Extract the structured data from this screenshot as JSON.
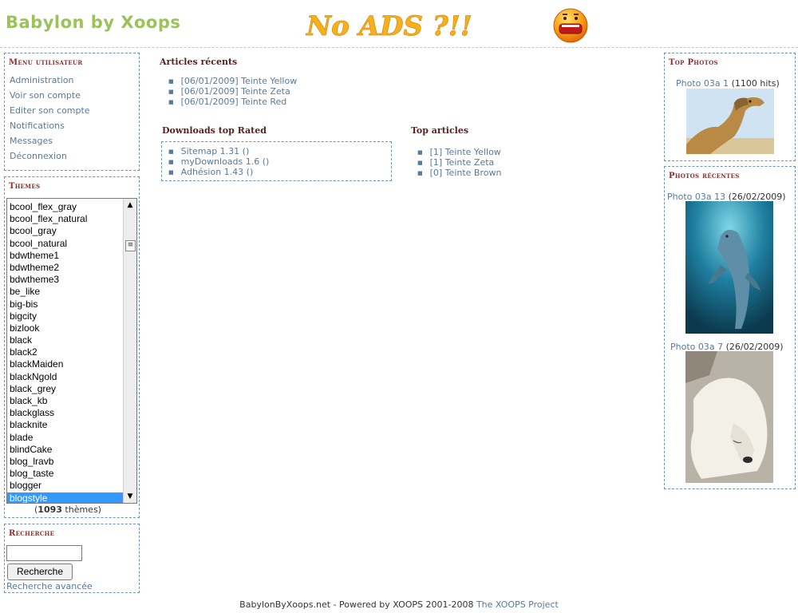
{
  "header": {
    "site_title": "Babylon by Xoops",
    "banner_text": "No ADS ?!!"
  },
  "user_menu": {
    "title": "Menu utilisateur",
    "items": [
      "Administration",
      "Voir son compte",
      "Editer son compte",
      "Notifications",
      "Messages",
      "Déconnexion"
    ]
  },
  "themes": {
    "title": "Themes",
    "items": [
      "bcool_flex_gray",
      "bcool_flex_natural",
      "bcool_gray",
      "bcool_natural",
      "bdwtheme1",
      "bdwtheme2",
      "bdwtheme3",
      "be_like",
      "big-bis",
      "bigcity",
      "bizlook",
      "black",
      "black2",
      "blackMaiden",
      "blackNgold",
      "black_grey",
      "black_kb",
      "blackglass",
      "blacknite",
      "blade",
      "blindCake",
      "blog_lravb",
      "blog_taste",
      "blogger",
      "blogstyle"
    ],
    "selected": "blogstyle",
    "count_open": "(",
    "count": "1093",
    "count_suffix": " thèmes)"
  },
  "search": {
    "title": "Recherche",
    "input_value": "",
    "button_label": "Recherche",
    "advanced_link": "Recherche avancée"
  },
  "recent_articles": {
    "title": "Articles récents",
    "items": [
      "[06/01/2009] Teinte Yellow",
      "[06/01/2009] Teinte Zeta",
      "[06/01/2009] Teinte Red"
    ]
  },
  "downloads_top_rated": {
    "title": "Downloads top Rated",
    "items": [
      "Sitemap 1.31 ()",
      "myDownloads 1.6 ()",
      "Adhésion 1.43 ()"
    ]
  },
  "top_articles": {
    "title": "Top articles",
    "items": [
      "[1] Teinte Yellow",
      "[1] Teinte Zeta",
      "[0] Teinte Brown"
    ]
  },
  "top_photos": {
    "title": "Top Photos",
    "photo_link": "Photo 03a 1",
    "photo_meta": " (1100 hits)"
  },
  "recent_photos": {
    "title": "Photos récentes",
    "items": [
      {
        "link": "Photo 03a 13",
        "date": " (26/02/2009)"
      },
      {
        "link": "Photo 03a 7",
        "date": " (26/02/2009)"
      }
    ]
  },
  "footer": {
    "text": "BabylonByXoops.net - Powered by XOOPS 2001-2008 ",
    "link": "The XOOPS Project"
  },
  "colors": {
    "title_green": "#9bc25b",
    "block_title": "#8b2e2e",
    "link": "#5a7a9a",
    "border": "#6f93b4",
    "selection": "#3399ff"
  }
}
